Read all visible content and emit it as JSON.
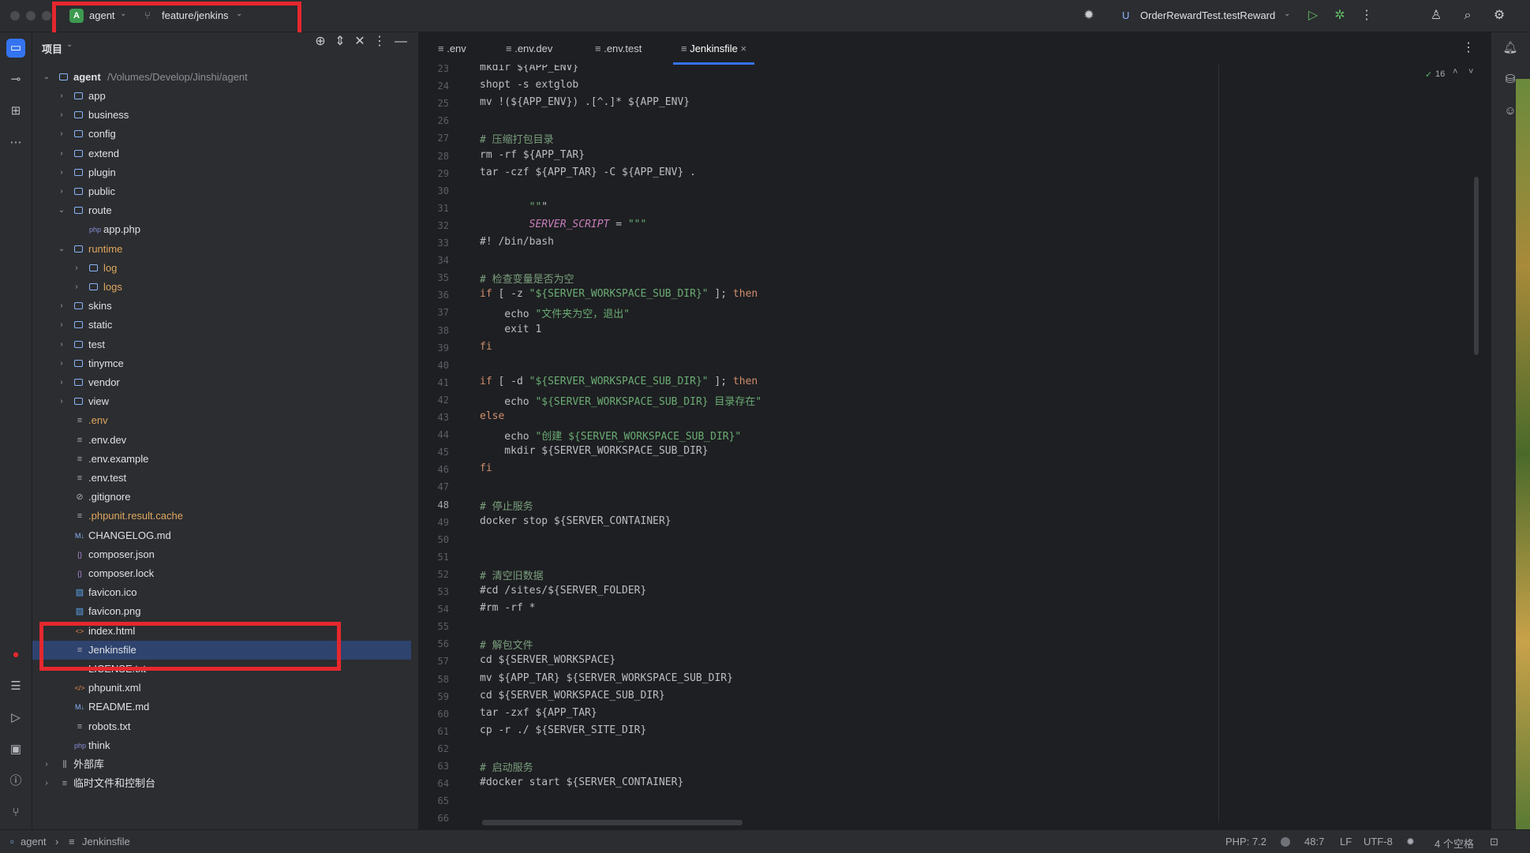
{
  "titlebar": {
    "project_badge": "A",
    "project_name": "agent",
    "branch": "feature/jenkins",
    "run_config": "OrderRewardTest.testReward"
  },
  "project_panel": {
    "title": "项目",
    "root_name": "agent",
    "root_path": "/Volumes/Develop/Jinshi/agent",
    "items": [
      {
        "label": "app",
        "kind": "folder",
        "depth": 1,
        "expanded": false
      },
      {
        "label": "business",
        "kind": "folder",
        "depth": 1,
        "expanded": false
      },
      {
        "label": "config",
        "kind": "folder",
        "depth": 1,
        "expanded": false
      },
      {
        "label": "extend",
        "kind": "folder",
        "depth": 1,
        "expanded": false
      },
      {
        "label": "plugin",
        "kind": "folder",
        "depth": 1,
        "expanded": false
      },
      {
        "label": "public",
        "kind": "folder",
        "depth": 1,
        "expanded": false
      },
      {
        "label": "route",
        "kind": "folder",
        "depth": 1,
        "expanded": true
      },
      {
        "label": "app.php",
        "kind": "php",
        "depth": 2
      },
      {
        "label": "runtime",
        "kind": "folder",
        "depth": 1,
        "expanded": true,
        "color": "#e0a75f"
      },
      {
        "label": "log",
        "kind": "folder",
        "depth": 2,
        "expanded": false,
        "color": "#e0a75f"
      },
      {
        "label": "logs",
        "kind": "folder",
        "depth": 2,
        "expanded": false,
        "color": "#e0a75f"
      },
      {
        "label": "skins",
        "kind": "folder",
        "depth": 1,
        "expanded": false
      },
      {
        "label": "static",
        "kind": "folder",
        "depth": 1,
        "expanded": false
      },
      {
        "label": "test",
        "kind": "folder",
        "depth": 1,
        "expanded": false
      },
      {
        "label": "tinymce",
        "kind": "folder",
        "depth": 1,
        "expanded": false
      },
      {
        "label": "vendor",
        "kind": "folder",
        "depth": 1,
        "expanded": false
      },
      {
        "label": "view",
        "kind": "folder",
        "depth": 1,
        "expanded": false
      },
      {
        "label": ".env",
        "kind": "text",
        "depth": 1,
        "color": "#e0a75f"
      },
      {
        "label": ".env.dev",
        "kind": "text",
        "depth": 1
      },
      {
        "label": ".env.example",
        "kind": "text",
        "depth": 1
      },
      {
        "label": ".env.test",
        "kind": "text",
        "depth": 1
      },
      {
        "label": ".gitignore",
        "kind": "ignore",
        "depth": 1
      },
      {
        "label": ".phpunit.result.cache",
        "kind": "text",
        "depth": 1,
        "color": "#e0a75f"
      },
      {
        "label": "CHANGELOG.md",
        "kind": "md",
        "depth": 1
      },
      {
        "label": "composer.json",
        "kind": "json",
        "depth": 1
      },
      {
        "label": "composer.lock",
        "kind": "json",
        "depth": 1
      },
      {
        "label": "favicon.ico",
        "kind": "image",
        "depth": 1
      },
      {
        "label": "favicon.png",
        "kind": "image",
        "depth": 1
      },
      {
        "label": "index.html",
        "kind": "html",
        "depth": 1
      },
      {
        "label": "Jenkinsfile",
        "kind": "text",
        "depth": 1,
        "selected": true
      },
      {
        "label": "LICENSE.txt",
        "kind": "text",
        "depth": 1
      },
      {
        "label": "phpunit.xml",
        "kind": "xml",
        "depth": 1
      },
      {
        "label": "README.md",
        "kind": "md",
        "depth": 1
      },
      {
        "label": "robots.txt",
        "kind": "text",
        "depth": 1
      },
      {
        "label": "think",
        "kind": "php",
        "depth": 1
      }
    ],
    "extra_roots": [
      {
        "label": "外部库",
        "icon": "library-icon"
      },
      {
        "label": "临时文件和控制台",
        "icon": "scratches-icon"
      }
    ]
  },
  "tabs": [
    {
      "label": ".env",
      "active": false
    },
    {
      "label": ".env.dev",
      "active": false
    },
    {
      "label": ".env.test",
      "active": false
    },
    {
      "label": "Jenkinsfile",
      "active": true
    }
  ],
  "editor": {
    "inspection_count": "16",
    "current_line": 48,
    "lines": [
      {
        "n": 23,
        "text": "mkdir ${APP_ENV}",
        "cls": ""
      },
      {
        "n": 24,
        "text": "shopt -s extglob",
        "cls": ""
      },
      {
        "n": 25,
        "text": "mv !(${APP_ENV}) .[^.]* ${APP_ENV}",
        "cls": ""
      },
      {
        "n": 26,
        "text": "",
        "cls": ""
      },
      {
        "n": 27,
        "text": "# 压缩打包目录",
        "cls": "c-comment"
      },
      {
        "n": 28,
        "text": "rm -rf ${APP_TAR}",
        "cls": ""
      },
      {
        "n": 29,
        "text": "tar -czf ${APP_TAR} -C ${APP_ENV} .",
        "cls": ""
      },
      {
        "n": 30,
        "text": "",
        "cls": ""
      },
      {
        "n": 31,
        "text": "        \"\"\"",
        "cls": ""
      },
      {
        "n": 32,
        "text": "        SERVER_SCRIPT = \"\"\"",
        "cls": "mix-var"
      },
      {
        "n": 33,
        "text": "#! /bin/bash",
        "cls": ""
      },
      {
        "n": 34,
        "text": "",
        "cls": ""
      },
      {
        "n": 35,
        "text": "# 检查变量是否为空",
        "cls": "c-comment"
      },
      {
        "n": 36,
        "text": "if [ -z \"${SERVER_WORKSPACE_SUB_DIR}\" ]; then",
        "cls": ""
      },
      {
        "n": 37,
        "text": "    echo \"文件夹为空，退出\"",
        "cls": ""
      },
      {
        "n": 38,
        "text": "    exit 1",
        "cls": ""
      },
      {
        "n": 39,
        "text": "fi",
        "cls": ""
      },
      {
        "n": 40,
        "text": "",
        "cls": ""
      },
      {
        "n": 41,
        "text": "if [ -d \"${SERVER_WORKSPACE_SUB_DIR}\" ]; then",
        "cls": ""
      },
      {
        "n": 42,
        "text": "    echo \"${SERVER_WORKSPACE_SUB_DIR} 目录存在\"",
        "cls": ""
      },
      {
        "n": 43,
        "text": "else",
        "cls": ""
      },
      {
        "n": 44,
        "text": "    echo \"创建 ${SERVER_WORKSPACE_SUB_DIR}\"",
        "cls": ""
      },
      {
        "n": 45,
        "text": "    mkdir ${SERVER_WORKSPACE_SUB_DIR}",
        "cls": ""
      },
      {
        "n": 46,
        "text": "fi",
        "cls": ""
      },
      {
        "n": 47,
        "text": "",
        "cls": ""
      },
      {
        "n": 48,
        "text": "# 停止服务",
        "cls": "c-comment"
      },
      {
        "n": 49,
        "text": "docker stop ${SERVER_CONTAINER}",
        "cls": ""
      },
      {
        "n": 50,
        "text": "",
        "cls": ""
      },
      {
        "n": 51,
        "text": "",
        "cls": ""
      },
      {
        "n": 52,
        "text": "# 清空旧数据",
        "cls": "c-comment"
      },
      {
        "n": 53,
        "text": "#cd /sites/${SERVER_FOLDER}",
        "cls": ""
      },
      {
        "n": 54,
        "text": "#rm -rf *",
        "cls": ""
      },
      {
        "n": 55,
        "text": "",
        "cls": ""
      },
      {
        "n": 56,
        "text": "# 解包文件",
        "cls": "c-comment"
      },
      {
        "n": 57,
        "text": "cd ${SERVER_WORKSPACE}",
        "cls": ""
      },
      {
        "n": 58,
        "text": "mv ${APP_TAR} ${SERVER_WORKSPACE_SUB_DIR}",
        "cls": ""
      },
      {
        "n": 59,
        "text": "cd ${SERVER_WORKSPACE_SUB_DIR}",
        "cls": ""
      },
      {
        "n": 60,
        "text": "tar -zxf ${APP_TAR}",
        "cls": ""
      },
      {
        "n": 61,
        "text": "cp -r ./ ${SERVER_SITE_DIR}",
        "cls": ""
      },
      {
        "n": 62,
        "text": "",
        "cls": ""
      },
      {
        "n": 63,
        "text": "# 启动服务",
        "cls": "c-comment"
      },
      {
        "n": 64,
        "text": "#docker start ${SERVER_CONTAINER}",
        "cls": ""
      },
      {
        "n": 65,
        "text": "",
        "cls": ""
      },
      {
        "n": 66,
        "text": "",
        "cls": ""
      }
    ]
  },
  "statusbar": {
    "crumb_root": "agent",
    "crumb_file": "Jenkinsfile",
    "php_version": "PHP: 7.2",
    "position": "48:7",
    "line_sep": "LF",
    "encoding": "UTF-8",
    "indent": "4 个空格"
  },
  "colors": {
    "accent": "#3574f0",
    "highlight_box": "#e5282e",
    "selection": "#2e436e"
  }
}
